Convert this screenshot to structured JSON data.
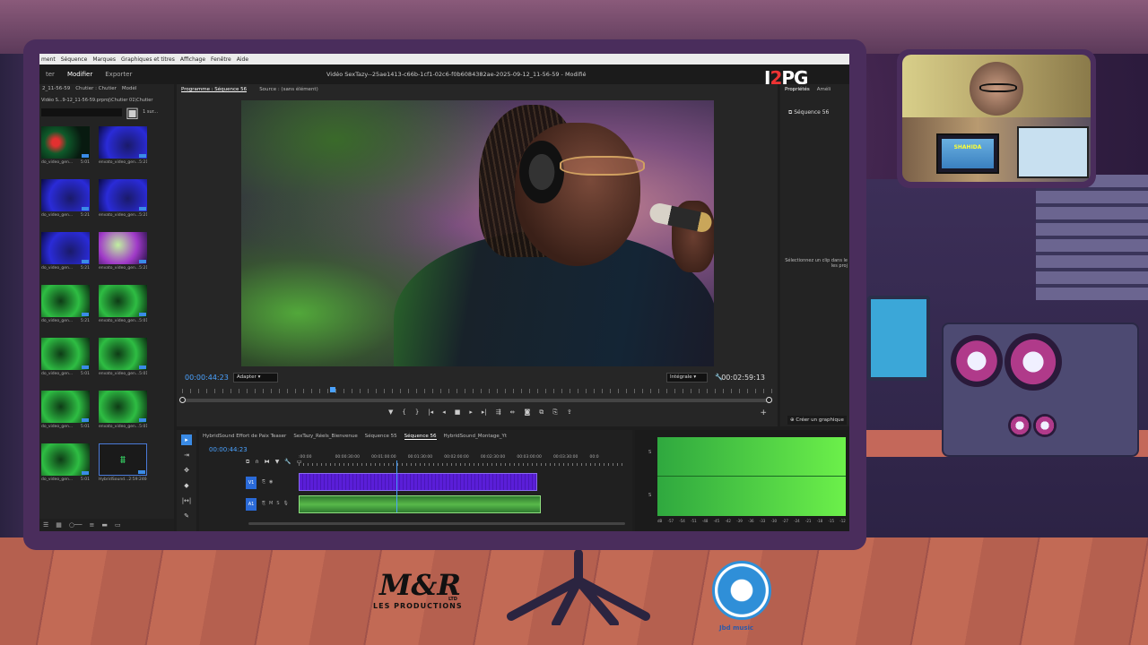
{
  "menubar": {
    "items": [
      "ment",
      "Séquence",
      "Marques",
      "Graphiques et titres",
      "Affichage",
      "Fenêtre",
      "Aide"
    ]
  },
  "workspace": {
    "tabs": [
      "ter",
      "Modifier",
      "Exporter"
    ],
    "active_tab": "Modifier",
    "document_title": "Vidéo SexTazy--25ae1413-c66b-1cf1-02c6-f0b6084382ae-2025-09-12_11-56-59 - Modifié"
  },
  "overlay_logo": {
    "prefix": "J",
    "accent": "2",
    "suffix": "PG"
  },
  "project": {
    "tabs": [
      "2_11-56-59",
      "Chutier : Chutier",
      "Modèl"
    ],
    "path": "Vidéo S...9-12_11-56-59.prproj\\Chutier  01\\Chutier",
    "search_placeholder": "",
    "count": "1 sur...",
    "items": [
      {
        "name": "do_video_gen...",
        "duration": "5:01",
        "style": "red"
      },
      {
        "name": "envato_video_gen...",
        "duration": "5:21",
        "style": "blue"
      },
      {
        "name": "do_video_gen...",
        "duration": "5:21",
        "style": "blue"
      },
      {
        "name": "envato_video_gen...",
        "duration": "5:21",
        "style": "blue"
      },
      {
        "name": "do_video_gen...",
        "duration": "5:21",
        "style": "blue"
      },
      {
        "name": "envato_video_gen...",
        "duration": "5:21",
        "style": "mix"
      },
      {
        "name": "do_video_gen...",
        "duration": "5:21",
        "style": "green"
      },
      {
        "name": "envato_video_gen...",
        "duration": "5:01",
        "style": "green"
      },
      {
        "name": "do_video_gen...",
        "duration": "5:01",
        "style": "green"
      },
      {
        "name": "envato_video_gen...",
        "duration": "5:01",
        "style": "green"
      },
      {
        "name": "do_video_gen...",
        "duration": "5:01",
        "style": "green"
      },
      {
        "name": "envato_video_gen...",
        "duration": "5:01",
        "style": "green"
      },
      {
        "name": "do_video_gen...",
        "duration": "5:01",
        "style": "green"
      },
      {
        "name": "HybridSound...",
        "duration": "2:59:24605",
        "style": "audio"
      }
    ]
  },
  "program": {
    "tabs": [
      "Programme : Séquence 56",
      "Source : (sans élément)"
    ],
    "timecode_current": "00:00:44:23",
    "timecode_total": "00:02:59:13",
    "fit": "Adapter",
    "quality": "Intégrale",
    "transport_icons": [
      "marker-icon",
      "in-point-icon",
      "out-point-icon",
      "go-to-in-icon",
      "step-back-icon",
      "stop-icon",
      "play-icon",
      "step-forward-icon",
      "lift-icon",
      "extract-icon",
      "export-frame-icon",
      "compare-icon",
      "overlay-icon",
      "share-icon"
    ],
    "transport_glyphs": [
      "▼",
      "{",
      "}",
      "|◂",
      "◂",
      "■",
      "▸",
      "▸|",
      "⇶",
      "⇷",
      "◙",
      "⧉",
      "⎘",
      "⇪"
    ],
    "playhead_position": 0.25
  },
  "properties": {
    "tabs": [
      "Propriétés",
      "Améli"
    ],
    "sequence": "Séquence 56",
    "hint": "Sélectionnez un clip dans le les proj",
    "create_button": "Créer un graphique"
  },
  "timeline": {
    "tabs": [
      "HybridSound Effort de Paix Teaser",
      "SexTazy_Réels_Bienvenue",
      "Séquence 55",
      "Séquence 56",
      "HybridSound_Montage_Yt"
    ],
    "active_tab": "Séquence 56",
    "timecode": "00:00:44:23",
    "ruler": [
      ":00:00",
      "00:00:30:00",
      "00:01:00:00",
      "00:01:30:00",
      "00:02:00:00",
      "00:02:30:00",
      "00:03:00:00",
      "00:03:30:00",
      "00:0"
    ],
    "tracks": [
      {
        "id": "V1",
        "label": "V1"
      },
      {
        "id": "A1",
        "label": "A1",
        "flags": [
          "M",
          "S"
        ]
      }
    ]
  },
  "meter": {
    "scale": [
      "dB",
      "-57",
      "-54",
      "-51",
      "-48",
      "-45",
      "-42",
      "-39",
      "-36",
      "-33",
      "-30",
      "-27",
      "-24",
      "-21",
      "-18",
      "-15",
      "-12"
    ],
    "side_labels": [
      "S",
      "S"
    ]
  },
  "webcam": {
    "screen_text": "SHAHIDA"
  },
  "logos": {
    "mr_main": "M&R",
    "mr_ltd": "LTD",
    "mr_sub": "LES PRODUCTIONS",
    "jbd": "Jbd music"
  },
  "colors": {
    "accent_blue": "#4aa2ff",
    "video_track": "#5a1ed8",
    "audio_track": "#58b94a",
    "meter_green": "#6cf04a"
  }
}
